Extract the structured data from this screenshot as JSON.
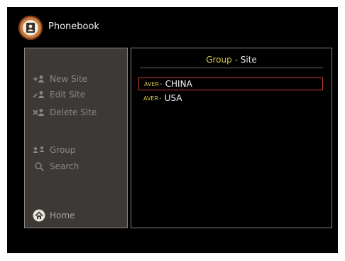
{
  "app": {
    "title": "Phonebook",
    "icon": "phonebook-icon",
    "accent": "#c77a3c"
  },
  "sidebar": {
    "items": [
      {
        "label": "New Site",
        "icon": "add-contact-icon"
      },
      {
        "label": "Edit Site",
        "icon": "edit-contact-icon"
      },
      {
        "label": "Delete Site",
        "icon": "delete-contact-icon"
      },
      {
        "label": "Group",
        "icon": "group-icon"
      },
      {
        "label": "Search",
        "icon": "search-icon"
      }
    ],
    "home": {
      "label": "Home",
      "icon": "home-icon"
    }
  },
  "panel": {
    "title_group": "Group",
    "title_separator": "-",
    "title_site": "Site",
    "rows": [
      {
        "group": "AVER",
        "separator": "-",
        "site": "CHINA",
        "selected": true
      },
      {
        "group": "AVER",
        "separator": "-",
        "site": "USA",
        "selected": false
      }
    ]
  },
  "colors": {
    "background": "#000000",
    "sidebar_bg": "#3c3936",
    "border": "#8b857d",
    "group_text": "#d8c44a",
    "selection": "#c44235"
  }
}
